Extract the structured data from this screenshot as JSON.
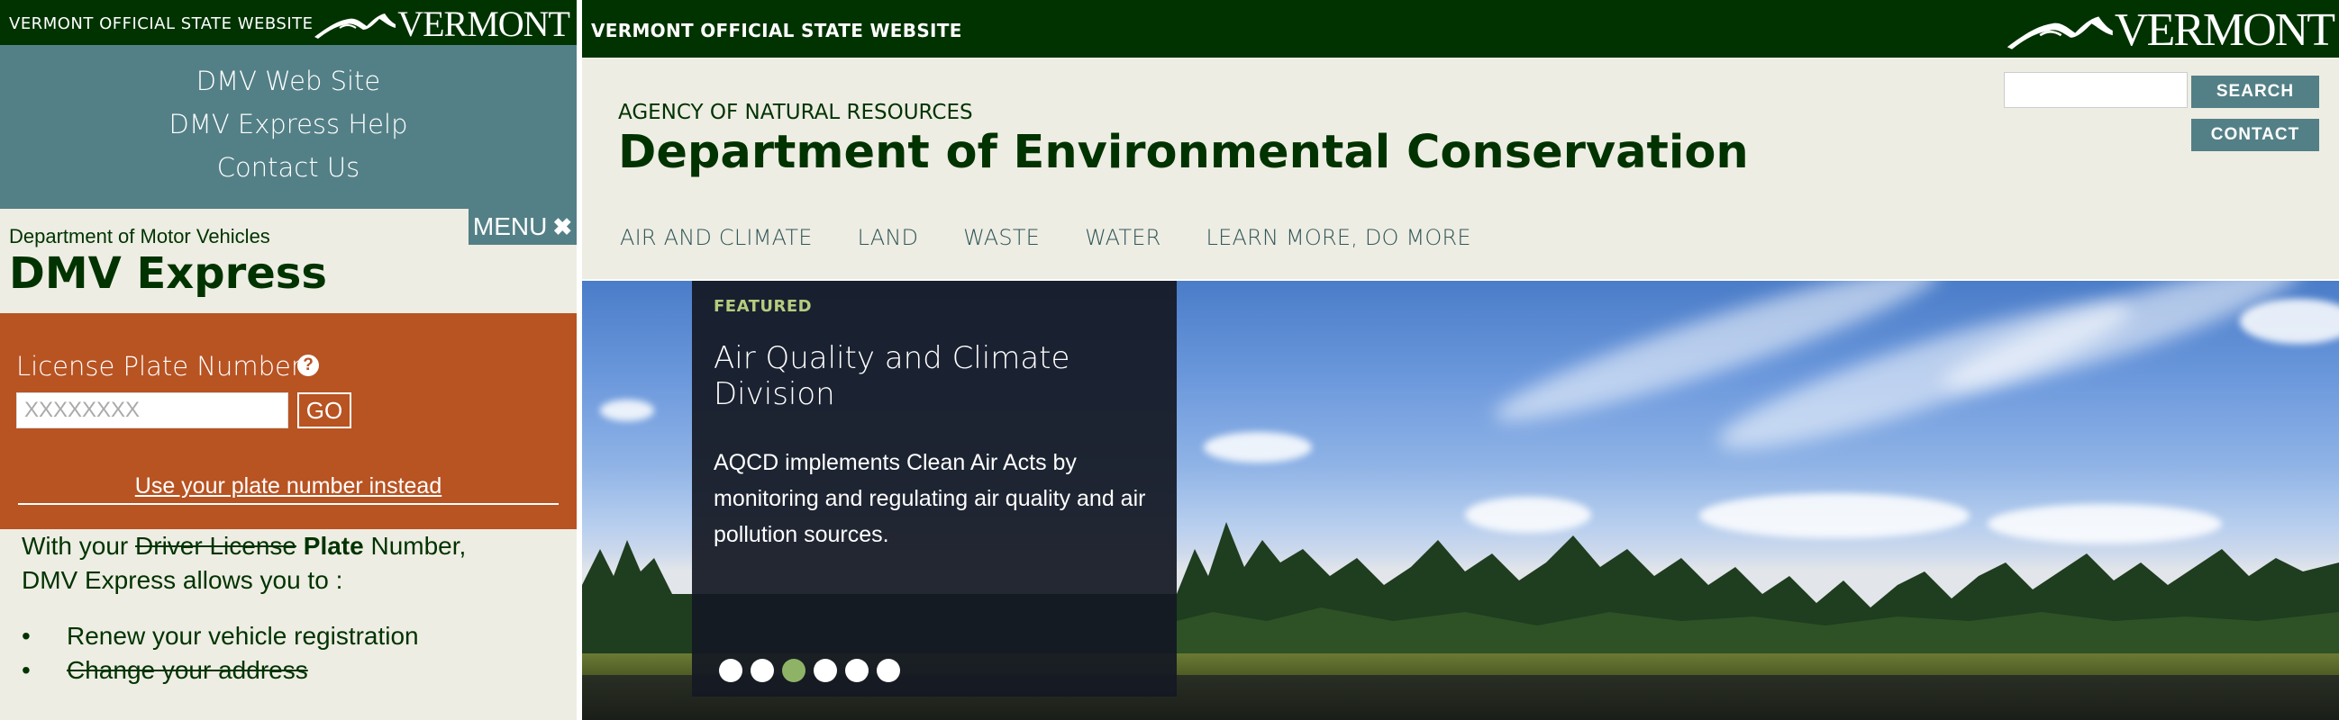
{
  "colors": {
    "vt_green": "#003300",
    "teal": "#538086",
    "orange": "#b85322",
    "cream": "#eeede3",
    "carousel_active_dot": "#8fb366"
  },
  "left": {
    "topbar": {
      "text": "VERMONT OFFICIAL STATE WEBSITE",
      "logo_word": "VERMONT",
      "logo_icon": "vermont-mountain-logo"
    },
    "nav": [
      "DMV Web Site",
      "DMV Express Help",
      "Contact Us"
    ],
    "menu": {
      "label": "MENU",
      "icon": "close-icon"
    },
    "dept": "Department of Motor Vehicles",
    "title": "DMV Express",
    "form": {
      "label": "License Plate Number",
      "help_icon": "question-circle-icon",
      "placeholder": "XXXXXXXX",
      "go": "GO",
      "alt_link": "Use your plate number instead"
    },
    "intro": {
      "pre": "With your ",
      "struck": "Driver License",
      "bold": "Plate",
      "post": " Number,",
      "line2": "DMV Express allows you to :"
    },
    "list": [
      {
        "text": "Renew your vehicle registration"
      },
      {
        "text": "Change your address"
      }
    ]
  },
  "right": {
    "topbar": {
      "text": "VERMONT OFFICIAL STATE WEBSITE",
      "logo_word": "VERMONT",
      "logo_icon": "vermont-mountain-logo"
    },
    "search_button": "SEARCH",
    "contact_button": "CONTACT",
    "agency": "AGENCY OF NATURAL RESOURCES",
    "title": "Department of Environmental Conservation",
    "nav": [
      "AIR AND CLIMATE",
      "LAND",
      "WASTE",
      "WATER",
      "LEARN MORE, DO MORE"
    ],
    "featured": {
      "tag": "FEATURED",
      "title": "Air Quality and Climate Division",
      "description": "AQCD implements Clean Air Acts by monitoring and regulating air quality and air pollution sources.",
      "slide_count": 6,
      "active_slide": 3
    }
  }
}
